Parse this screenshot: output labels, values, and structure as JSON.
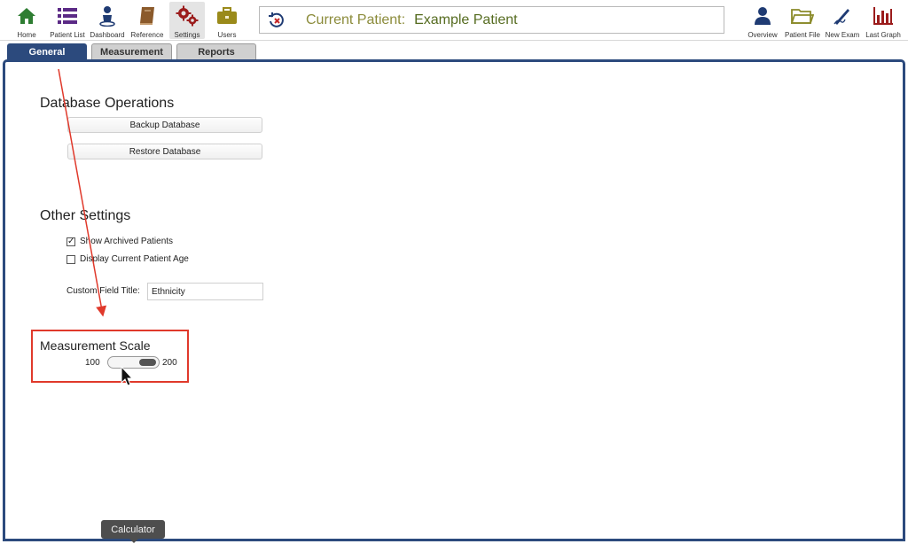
{
  "toolbar": {
    "left_items": [
      {
        "label": "Home",
        "icon": "home-icon",
        "color": "#2e7d32"
      },
      {
        "label": "Patient List",
        "icon": "list-icon",
        "color": "#5b2a86"
      },
      {
        "label": "Dashboard",
        "icon": "person-pin-icon",
        "color": "#1f3b73"
      },
      {
        "label": "Reference",
        "icon": "book-icon",
        "color": "#8b5a2b"
      },
      {
        "label": "Settings",
        "icon": "gears-icon",
        "color": "#9b1c1c"
      },
      {
        "label": "Users",
        "icon": "briefcase-icon",
        "color": "#9a8a1a"
      }
    ],
    "right_items": [
      {
        "label": "Overview",
        "icon": "person-icon",
        "color": "#1f3b73"
      },
      {
        "label": "Patient File",
        "icon": "folder-icon",
        "color": "#8b8b2a"
      },
      {
        "label": "New Exam",
        "icon": "pen-icon",
        "color": "#1f3b73"
      },
      {
        "label": "Last Graph",
        "icon": "bar-chart-icon",
        "color": "#9b1c1c"
      }
    ],
    "active": "Settings"
  },
  "patient": {
    "label": "Current Patient:",
    "name": "Example Patient"
  },
  "tabs": [
    {
      "label": "General",
      "active": true
    },
    {
      "label": "Measurement",
      "active": false
    },
    {
      "label": "Reports",
      "active": false
    }
  ],
  "database": {
    "title": "Database Operations",
    "backup_label": "Backup Database",
    "restore_label": "Restore Database"
  },
  "other": {
    "title": "Other Settings",
    "show_archived_label": "Show Archived Patients",
    "show_archived_checked": true,
    "display_age_label": "Display Current Patient Age",
    "display_age_checked": false,
    "custom_field_label": "Custom Field Title:",
    "custom_field_value": "Ethnicity"
  },
  "scale": {
    "title": "Measurement Scale",
    "min_label": "100",
    "max_label": "200"
  },
  "tooltip": {
    "text": "Calculator"
  },
  "colors": {
    "accent": "#2c4a7d",
    "annotation": "#e0392b"
  }
}
